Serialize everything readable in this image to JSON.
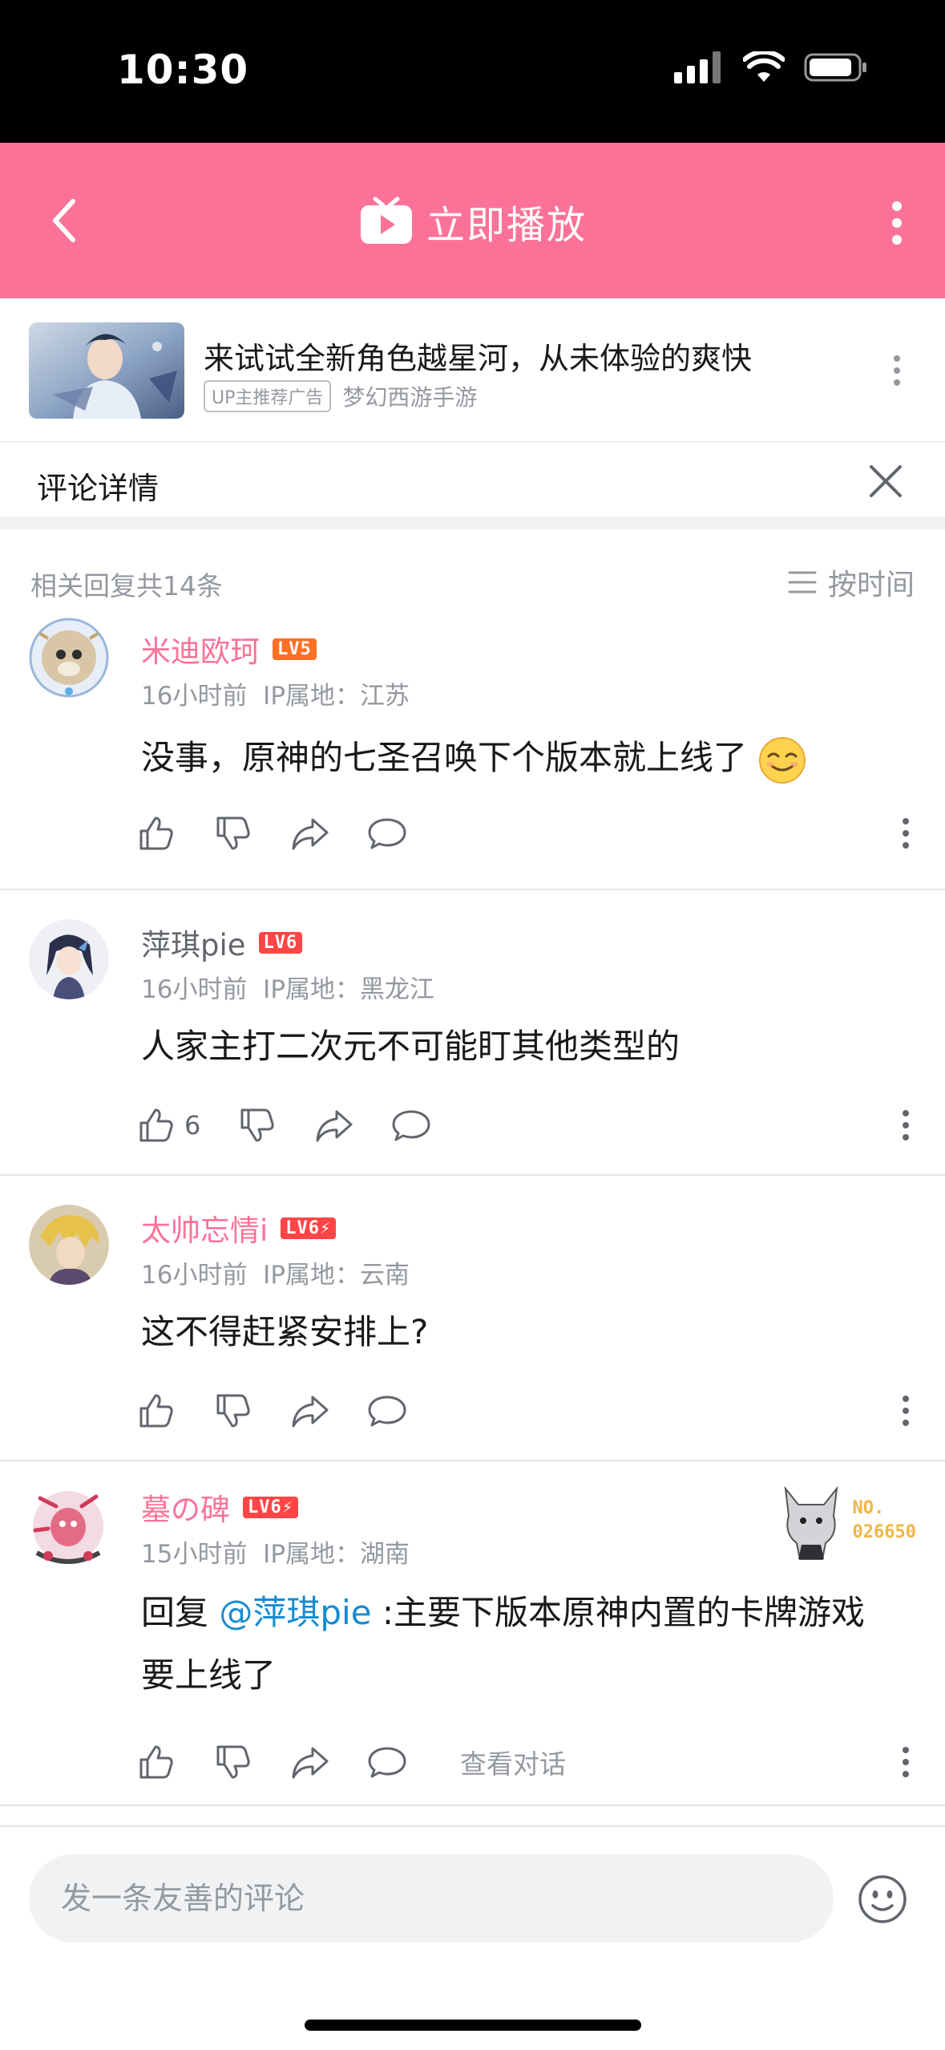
{
  "status_bar": {
    "time": "10:30"
  },
  "header": {
    "play_label": "立即播放"
  },
  "ad": {
    "title": "来试试全新角色越星河，从未体验的爽快",
    "tag": "UP主推荐广告",
    "source": "梦幻西游手游"
  },
  "detail": {
    "title": "评论详情"
  },
  "replies": {
    "count_text": "相关回复共14条",
    "sort_label": "按时间"
  },
  "comments": [
    {
      "username": "米迪欧珂",
      "level": "LV5",
      "level_color": "#ff6f24",
      "time": "16小时前",
      "ip": "IP属地：江苏",
      "content": "没事，原神的七圣召唤下个版本就上线了",
      "likes": ""
    },
    {
      "username": "萍琪pie",
      "level": "LV6",
      "level_color": "#ff4545",
      "time": "16小时前",
      "ip": "IP属地：黑龙江",
      "content": "人家主打二次元不可能盯其他类型的",
      "likes": "6"
    },
    {
      "username": "太帅忘情i",
      "level": "LV6⚡",
      "level_color": "#ff4545",
      "time": "16小时前",
      "ip": "IP属地：云南",
      "content": "这不得赶紧安排上?",
      "likes": ""
    },
    {
      "username": "墓の碑",
      "level": "LV6⚡",
      "level_color": "#ff4545",
      "time": "15小时前",
      "ip": "IP属地：湖南",
      "reply_prefix": "回复 ",
      "mention": "@萍琪pie",
      "content": " :主要下版本原神内置的卡牌游戏要上线了",
      "likes": "",
      "view_conversation": "查看对话",
      "fan_no_label": "NO.",
      "fan_no_value": "026650"
    }
  ],
  "input": {
    "placeholder": "发一条友善的评论"
  },
  "colors": {
    "brand_pink": "#fb7299",
    "mention_blue": "#178bcf"
  }
}
